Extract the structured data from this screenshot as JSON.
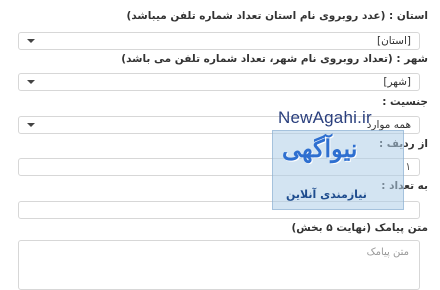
{
  "form": {
    "province_label": "استان : (عدد روبروی نام استان تعداد شماره تلفن میباشد)",
    "province_value": "[استان]",
    "city_label": "شهر : (تعداد روبروی نام شهر، تعداد شماره تلفن می باشد)",
    "city_value": "[شهر]",
    "gender_label": "جنسیت :",
    "gender_value": "همه موارد",
    "from_row_label": "از ردیف :",
    "from_row_value": "۱",
    "count_label": "به تعداد :",
    "count_value": "",
    "sms_label": "متن پیامک (نهایت ۵ بخش)",
    "sms_placeholder": "متن پیامک"
  },
  "watermark": {
    "site": "NewAgahi.ir",
    "logo": "نیوآگهی",
    "tagline": "نیازمندی آنلاین"
  },
  "colors": {
    "border": "#d7d7d7",
    "watermark": "#2a3f7d"
  }
}
